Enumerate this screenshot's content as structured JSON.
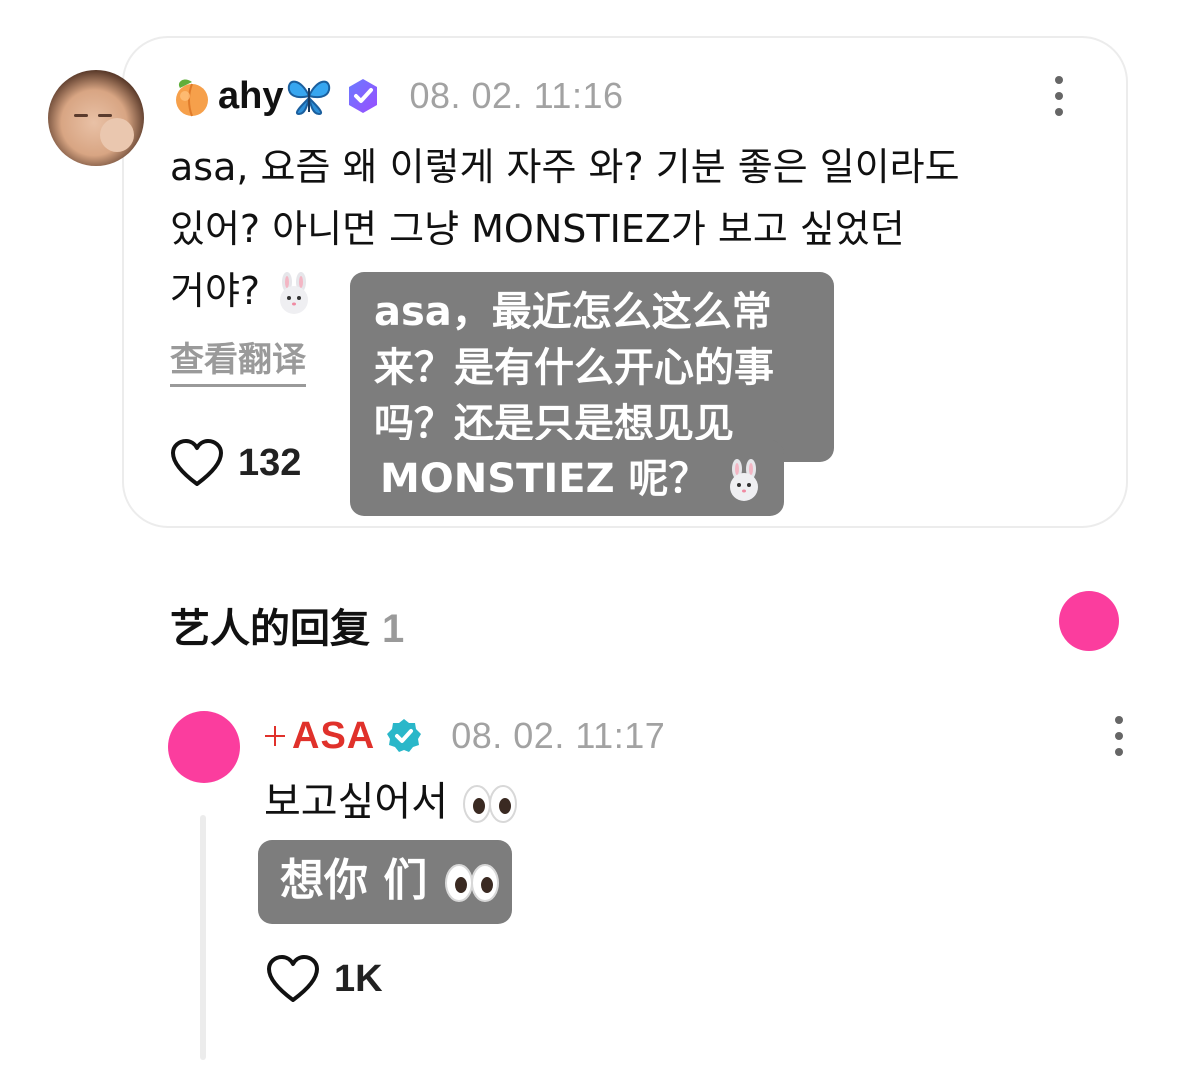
{
  "post": {
    "author": "ahy",
    "timestamp": "08. 02. 11:16",
    "lines": [
      "asa, 요즘 왜 이렇게 자주 와? 기분 좋은 일이라도",
      "있어? 아니면 그냥 MONSTIEZ가 보고 싶었던",
      "거야?"
    ],
    "translate_label": "查看翻译",
    "like_count": "132"
  },
  "translation_overlay": {
    "lines": [
      "asa，最近怎么这么常",
      "来？是有什么开心的事",
      "吗？还是只是想见见"
    ],
    "last_line": "MONSTIEZ 呢？"
  },
  "replies": {
    "title": "艺人的回复",
    "count": "1"
  },
  "reply": {
    "author": "ASA",
    "timestamp": "08. 02. 11:17",
    "text": "보고싶어서",
    "translation": "想你 们",
    "like_count": "1K"
  },
  "colors": {
    "accent_pink": "#fb3d9e",
    "asa_red": "#e0312b",
    "overlay_gray": "#7d7d7d",
    "timestamp_gray": "#a2a2a2"
  },
  "icons": [
    "peach-emoji-icon",
    "butterfly-emoji-icon",
    "verified-badge-icon",
    "rabbit-emoji-icon",
    "heart-icon",
    "more-options-icon",
    "eyes-emoji-icon"
  ]
}
